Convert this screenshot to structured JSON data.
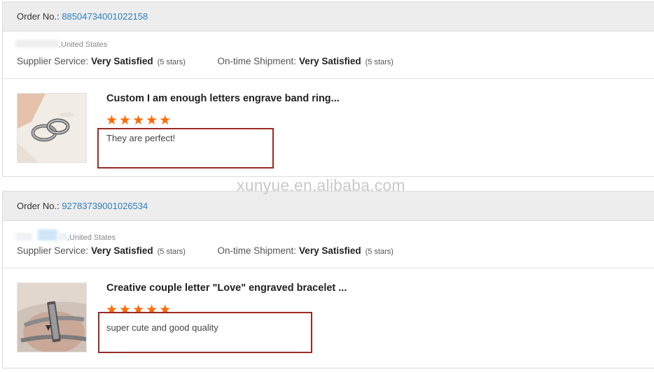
{
  "orders": [
    {
      "order_label": "Order No.:",
      "order_number": "88504734001022158",
      "buyer_location": ",United States",
      "supplier_service_label": "Supplier Service:",
      "supplier_service_value": "Very Satisfied",
      "supplier_service_count": "(5 stars)",
      "shipment_label": "On-time Shipment:",
      "shipment_value": "Very Satisfied",
      "shipment_count": "(5 stars)",
      "product_title": "Custom I am enough letters engrave band ring...",
      "rating": 5,
      "review": "They are perfect!"
    },
    {
      "order_label": "Order No.:",
      "order_number": "92783739001026534",
      "buyer_location": ",United States",
      "supplier_service_label": "Supplier Service:",
      "supplier_service_value": "Very Satisfied",
      "supplier_service_count": "(5 stars)",
      "shipment_label": "On-time Shipment:",
      "shipment_value": "Very Satisfied",
      "shipment_count": "(5 stars)",
      "product_title": "Creative couple letter \"Love\" engraved bracelet ...",
      "rating": 5,
      "review": "super cute and good quality"
    }
  ],
  "watermark": "xunyue.en.alibaba.com",
  "colors": {
    "star": "#ff6a00",
    "order_number": "#2f7fc0",
    "highlight_box": "#9a2a23",
    "header_bg": "#ededed"
  }
}
